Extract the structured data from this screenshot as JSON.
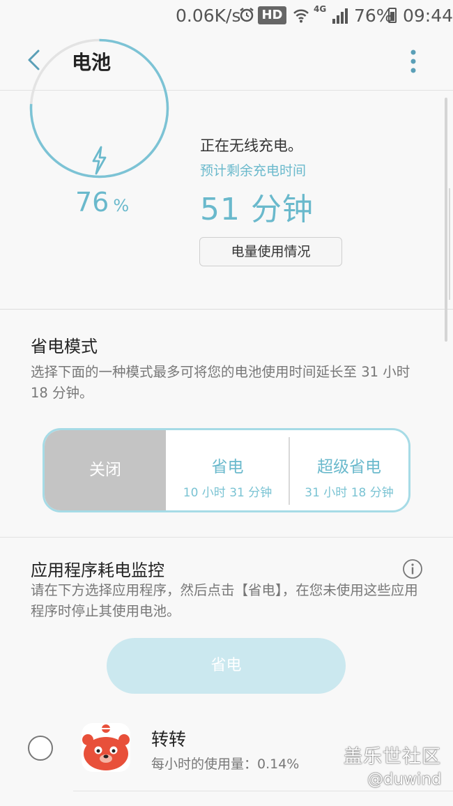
{
  "status_bar": {
    "net_speed": "0.06K/s",
    "hd": "HD",
    "network": "4G",
    "battery_percent": "76%",
    "time": "09:44",
    "icons": [
      "alarm-icon",
      "wifi-icon",
      "signal-icon",
      "battery-icon"
    ]
  },
  "header": {
    "title": "电池",
    "icons": [
      "back-icon",
      "more-options-icon"
    ]
  },
  "battery": {
    "level": 0.76,
    "percent_value": "76",
    "percent_sign": "%",
    "status": "正在无线充电。",
    "eta_label": "预计剩余充电时间",
    "eta_value": "51 分钟",
    "usage_button": "电量使用情况"
  },
  "power_mode": {
    "title": "省电模式",
    "description": "选择下面的一种模式最多可将您的电池使用时间延长至 31 小时 18 分钟。",
    "options": [
      {
        "name": "关闭",
        "sub": ""
      },
      {
        "name": "省电",
        "sub": "10 小时 31 分钟"
      },
      {
        "name": "超级省电",
        "sub": "31 小时 18 分钟"
      }
    ],
    "selected": "关闭"
  },
  "app_monitor": {
    "title": "应用程序耗电监控",
    "description": "请在下方选择应用程序，然后点击【省电】，在您未使用这些应用程序时停止其使用电池。",
    "save_button": "省电",
    "apps": [
      {
        "name": "转转",
        "usage": "每小时的使用量：0.14%"
      }
    ]
  },
  "watermark": {
    "line1": "盖乐世社区",
    "line2": "@duwind"
  },
  "colors": {
    "accent": "#6ab9cc",
    "selected_segment": "#c4c4c4",
    "disabled_button": "#cbe8ef"
  }
}
